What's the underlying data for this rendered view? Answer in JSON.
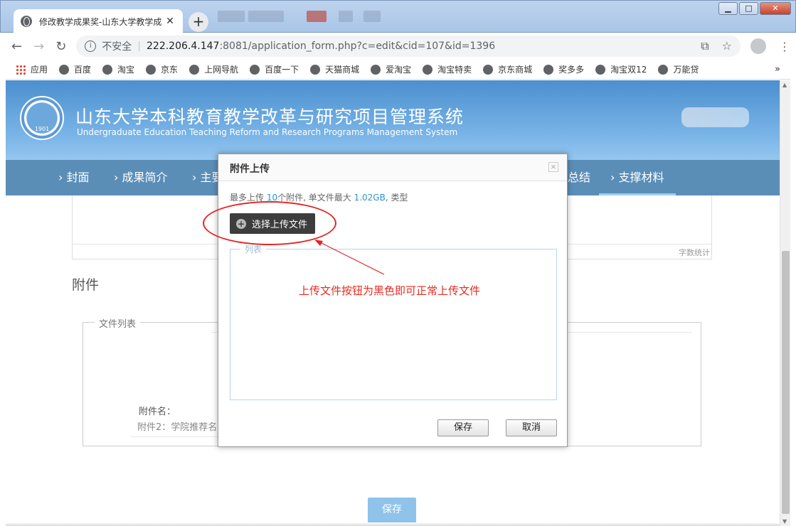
{
  "browser": {
    "tab_title": "修改教学成果奖-山东大学教学成",
    "tab_close": "✕",
    "new_tab": "+",
    "insecure_label": "不安全",
    "url_host": "222.206.4.147",
    "url_rest": ":8081/application_form.php?c=edit&cid=107&id=1396",
    "bookmarks": [
      "应用",
      "百度",
      "淘宝",
      "京东",
      "上网导航",
      "百度一下",
      "天猫商城",
      "爱淘宝",
      "淘宝特卖",
      "京东商城",
      "奖多多",
      "淘宝双12",
      "万能贷"
    ],
    "bookmarks_more": "»",
    "icons": [
      "back-icon",
      "forward-icon",
      "reload-icon",
      "info-icon",
      "extension-icon",
      "star-icon",
      "avatar",
      "menu-icon"
    ]
  },
  "header": {
    "title_cn": "山东大学本科教育教学改革与研究项目管理系统",
    "title_en": "Undergraduate Education Teaching Reform and Research Programs Management System",
    "logo_year": "1901"
  },
  "nav": {
    "items": [
      "封面",
      "成果简介",
      "主要",
      "总结",
      "支撑材料"
    ],
    "prefix": "›",
    "active": "支撑材料"
  },
  "page": {
    "word_count_label": "字数统计",
    "attachments_heading": "附件",
    "file_list_legend": "文件列表",
    "attachment_name_label": "附件名：",
    "attachment_name_value": "附件2：学院推荐名",
    "save_button": "保存"
  },
  "dialog": {
    "title": "附件上传",
    "close": "×",
    "hint_pre": "最多上传 ",
    "hint_count": "10",
    "hint_mid": "个附件, 单文件最大 ",
    "hint_size": "1.02GB",
    "hint_post": ", 类型",
    "pick_button": "选择上传文件",
    "list_legend": "列表",
    "save_button": "保存",
    "cancel_button": "取消"
  },
  "annotation": {
    "text": "上传文件按钮为黑色即可正常上传文件",
    "color": "#e42b1f"
  },
  "colors": {
    "banner": "#5b9bd5",
    "nav": "#5a8eb7",
    "pick_button": "#3d3d3d",
    "accent_number": "#2b93d5"
  }
}
